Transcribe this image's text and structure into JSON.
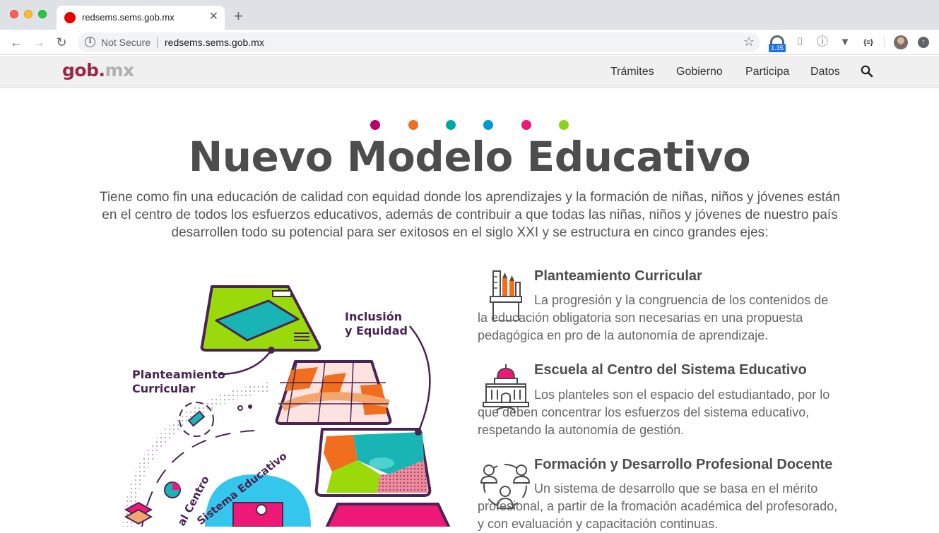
{
  "browser": {
    "tab_title": "redsems.sems.gob.mx",
    "not_secure_label": "Not Secure",
    "url": "redsems.sems.gob.mx",
    "extension_badge": "1.35"
  },
  "site": {
    "logo_gob": "gob",
    "logo_dot": ".",
    "logo_mx": "mx",
    "nav": [
      "Trámites",
      "Gobierno",
      "Participa",
      "Datos"
    ]
  },
  "hero": {
    "title": "Nuevo Modelo Educativo",
    "description": "Tiene como fin una educación de calidad con equidad donde los aprendizajes y la formación de niñas, niños y jóvenes están en el centro de todos los esfuerzos educativos, además de contribuir a que todas las niñas, niños y jóvenes de nuestro país desarrollen todo su potencial para ser exitosos en el siglo XXI y se estructura en cinco grandes ejes:",
    "dot_colors": [
      "#b8006b",
      "#f06e1d",
      "#00a99d",
      "#0096d6",
      "#ee1977",
      "#8cd317"
    ]
  },
  "illustration": {
    "label_inclusion_1": "Inclusión",
    "label_inclusion_2": "y Equidad",
    "label_curricular_1": "Planteamiento",
    "label_curricular_2": "Curricular",
    "label_escuela_1": "al Centro",
    "label_escuela_2": "Sistema Educativo"
  },
  "axes": [
    {
      "title": "Planteamiento Curricular",
      "description": "La progresión y la congruencia de los contenidos de la educación obligatoria son necesarias en una propuesta pedagógica en pro de la autonomía de aprendizaje.",
      "icon": "pencil-cup-icon"
    },
    {
      "title": "Escuela al Centro del Sistema Educativo",
      "description": "Los planteles son el espacio del estudiantado, por lo que deben concentrar los esfuerzos del sistema educativo, respetando la autonomía de gestión.",
      "icon": "capitol-building-icon"
    },
    {
      "title": "Formación y Desarrollo Profesional Docente",
      "description": "Un sistema de desarrollo que se basa en el mérito profesional, a partir de la fromación académica del profesorado, y con evaluación y capacitación continuas.",
      "icon": "people-circle-icon"
    }
  ]
}
